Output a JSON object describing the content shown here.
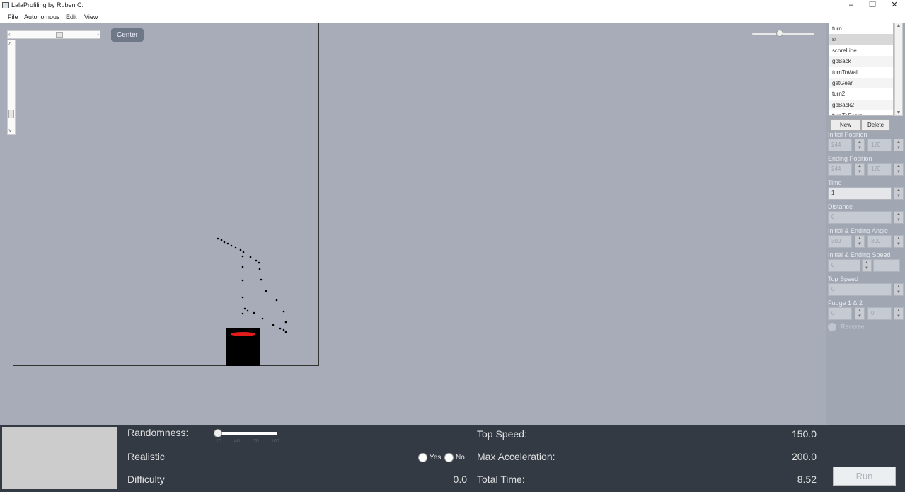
{
  "window": {
    "title": "LalaProfiling by Ruben C.",
    "minimize": "–",
    "maximize": "❐",
    "close": "✕"
  },
  "menu": [
    "File",
    "Autonomous",
    "Edit",
    "View"
  ],
  "canvas": {
    "center_label": "Center",
    "scroll_left": "‹",
    "scroll_right": "›",
    "scroll_up": "˄",
    "scroll_down": "˅"
  },
  "autonomous_list": {
    "items": [
      "turn",
      "st",
      "scoreLine",
      "goBack",
      "turnToWall",
      "getGear",
      "turn2",
      "goBack2",
      "turnToScore"
    ],
    "selected": "st",
    "scroll_up": "▲",
    "scroll_down": "▼"
  },
  "panel": {
    "new_label": "New",
    "delete_label": "Delete",
    "initial_position_label": "Initial Position",
    "initial_position": [
      "244",
      "120"
    ],
    "ending_position_label": "Ending Position",
    "ending_position": [
      "244",
      "120"
    ],
    "time_label": "Time",
    "time": "1",
    "distance_label": "Distance",
    "distance": "0",
    "angle_label": "Initial & Ending Angle",
    "angle": [
      "300",
      "300"
    ],
    "speed_label": "Initial & Ending Speed",
    "speed": [
      "0",
      ""
    ],
    "top_speed_label": "Top Speed",
    "top_speed": "0",
    "fudge_label": "Fudge 1 & 2",
    "fudge": [
      "0",
      "0"
    ],
    "reverse_label": "Reverse",
    "spin_up": "▲",
    "spin_down": "▼"
  },
  "bottom": {
    "randomness_label": "Randomness:",
    "randomness_ticks": [
      "10",
      "40",
      "70",
      "100"
    ],
    "randomness_value": 0.0,
    "realistic_label": "Realistic",
    "yes_label": "Yes",
    "no_label": "No",
    "difficulty_label": "Difficulty",
    "difficulty_value": "0.0",
    "top_speed_label": "Top Speed:",
    "top_speed_value": "150.0",
    "max_accel_label": "Max Acceleration:",
    "max_accel_value": "200.0",
    "total_time_label": "Total Time:",
    "total_time_value": "8.52",
    "run_label": "Run"
  },
  "colors": {
    "canvas_bg": "#a7acb8",
    "robot_body": "#000000",
    "robot_marker": "#e21b1b",
    "bottom_bar": "#333a44"
  }
}
